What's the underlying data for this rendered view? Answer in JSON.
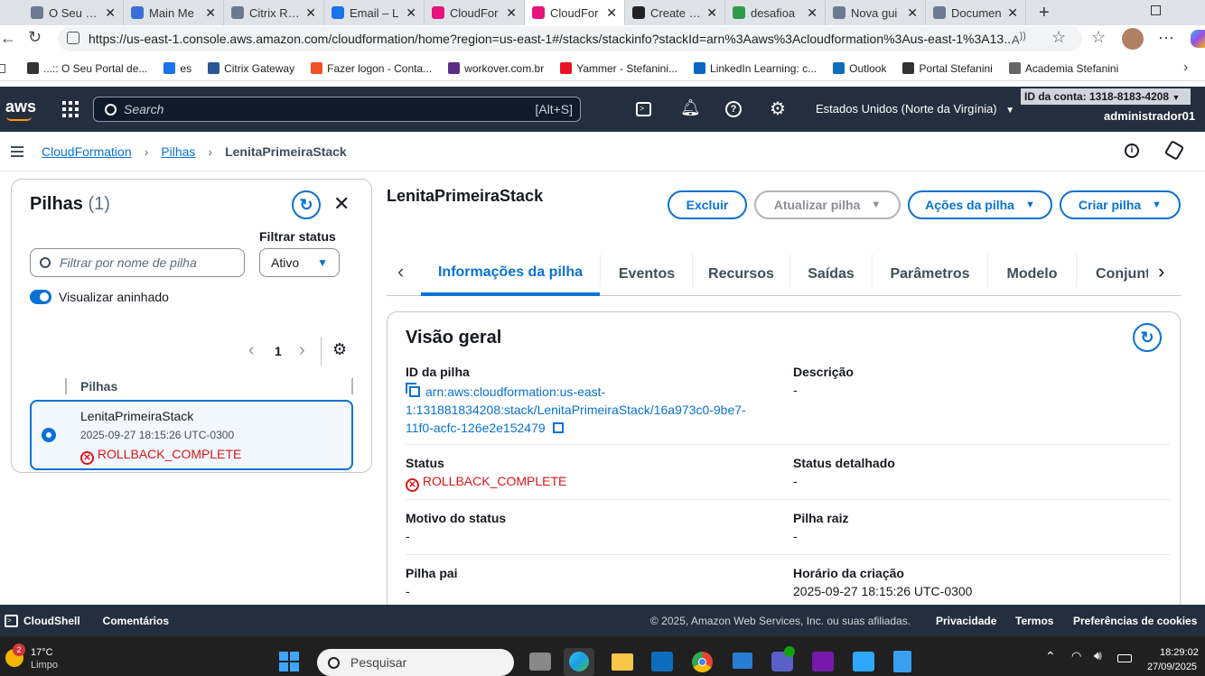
{
  "browser": {
    "tabs": [
      {
        "title": "O Seu Po",
        "color": "#6b7a8f"
      },
      {
        "title": "Main Me",
        "color": "#3a6fd8"
      },
      {
        "title": "Citrix Rec",
        "color": "#6b7a8f"
      },
      {
        "title": "Email – L",
        "color": "#1a73e8"
      },
      {
        "title": "CloudFor",
        "color": "#e7157b"
      },
      {
        "title": "CloudFor",
        "color": "#e7157b"
      },
      {
        "title": "Create co",
        "color": "#222222"
      },
      {
        "title": "desafioa",
        "color": "#2e9b4a"
      },
      {
        "title": "Nova gui",
        "color": "#6b7a8f"
      },
      {
        "title": "Documen",
        "color": "#6b7a8f"
      }
    ],
    "url": "https://us-east-1.console.aws.amazon.com/cloudformation/home?region=us-east-1#/stacks/stackinfo?stackId=arn%3Aaws%3Acloudformation%3Aus-east-1%3A13...",
    "bookmarks": [
      "...:: O Seu Portal de...",
      "es",
      "Citrix Gateway",
      "Fazer logon - Conta...",
      "workover.com.br",
      "Yammer - Stefanini...",
      "LinkedIn Learning: c...",
      "Outlook",
      "Portal Stefanini",
      "Academia Stefanini"
    ]
  },
  "aws_header": {
    "logo": "aws",
    "search_placeholder": "Search",
    "search_shortcut": "[Alt+S]",
    "region": "Estados Unidos (Norte da Virgínia)",
    "account_id": "ID da conta: 1318-8183-4208",
    "user": "administrador01"
  },
  "breadcrumb": {
    "items": [
      "CloudFormation",
      "Pilhas",
      "LenitaPrimeiraStack"
    ]
  },
  "left_panel": {
    "title": "Pilhas",
    "count": "(1)",
    "filter_placeholder": "Filtrar por nome de pilha",
    "filter_status_label": "Filtrar status",
    "filter_status_value": "Ativo",
    "toggle_label": "Visualizar aninhado",
    "page": "1",
    "column_header": "Pilhas",
    "stack": {
      "name": "LenitaPrimeiraStack",
      "date": "2025-09-27 18:15:26 UTC-0300",
      "status": "ROLLBACK_COMPLETE"
    }
  },
  "main": {
    "stack_name": "LenitaPrimeiraStack",
    "buttons": {
      "delete": "Excluir",
      "update": "Atualizar pilha",
      "actions": "Ações da pilha",
      "create": "Criar pilha"
    },
    "tabs": [
      "Informações da pilha",
      "Eventos",
      "Recursos",
      "Saídas",
      "Parâmetros",
      "Modelo",
      "Conjunt"
    ],
    "overview": {
      "title": "Visão geral",
      "stack_id_label": "ID da pilha",
      "stack_id_line1": "arn:aws:cloudformation:us-east-",
      "stack_id_line2": "1:131881834208:stack/LenitaPrimeiraStack/16a973c0-9be7-",
      "stack_id_line3": "11f0-acfc-126e2e152479",
      "description_label": "Descrição",
      "description_value": "-",
      "status_label": "Status",
      "status_value": "ROLLBACK_COMPLETE",
      "detailed_status_label": "Status detalhado",
      "detailed_status_value": "-",
      "status_reason_label": "Motivo do status",
      "status_reason_value": "-",
      "root_stack_label": "Pilha raiz",
      "root_stack_value": "-",
      "parent_stack_label": "Pilha pai",
      "parent_stack_value": "-",
      "creation_time_label": "Horário da criação",
      "creation_time_value": "2025-09-27 18:15:26 UTC-0300"
    }
  },
  "footer": {
    "cloudshell": "CloudShell",
    "feedback": "Comentários",
    "copyright": "© 2025, Amazon Web Services, Inc. ou suas afiliadas.",
    "privacy": "Privacidade",
    "terms": "Termos",
    "cookies": "Preferências de cookies"
  },
  "taskbar": {
    "weather_temp": "17°C",
    "weather_desc": "Limpo",
    "weather_badge": "2",
    "search": "Pesquisar",
    "time": "18:29:02",
    "date": "27/09/2025"
  },
  "colors": {
    "aws_nav": "#232f3e",
    "link": "#0972d3",
    "error": "#d91515"
  }
}
